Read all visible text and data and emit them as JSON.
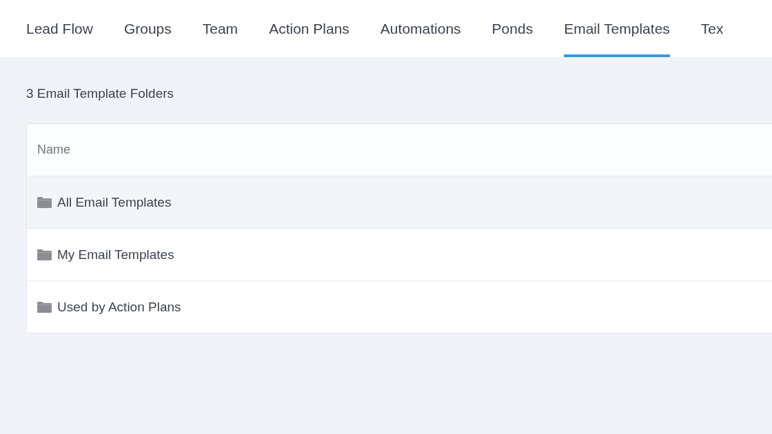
{
  "tabs": [
    {
      "label": "Lead Flow",
      "selected": false
    },
    {
      "label": "Groups",
      "selected": false
    },
    {
      "label": "Team",
      "selected": false
    },
    {
      "label": "Action Plans",
      "selected": false
    },
    {
      "label": "Automations",
      "selected": false
    },
    {
      "label": "Ponds",
      "selected": false
    },
    {
      "label": "Email Templates",
      "selected": true
    },
    {
      "label": "Tex",
      "selected": false
    }
  ],
  "folder_count": "3 Email Template Folders",
  "table": {
    "columns": [
      "Name"
    ],
    "rows": [
      {
        "name": "All Email Templates",
        "hovered": true
      },
      {
        "name": "My Email Templates",
        "hovered": false
      },
      {
        "name": "Used by Action Plans",
        "hovered": false
      }
    ]
  }
}
